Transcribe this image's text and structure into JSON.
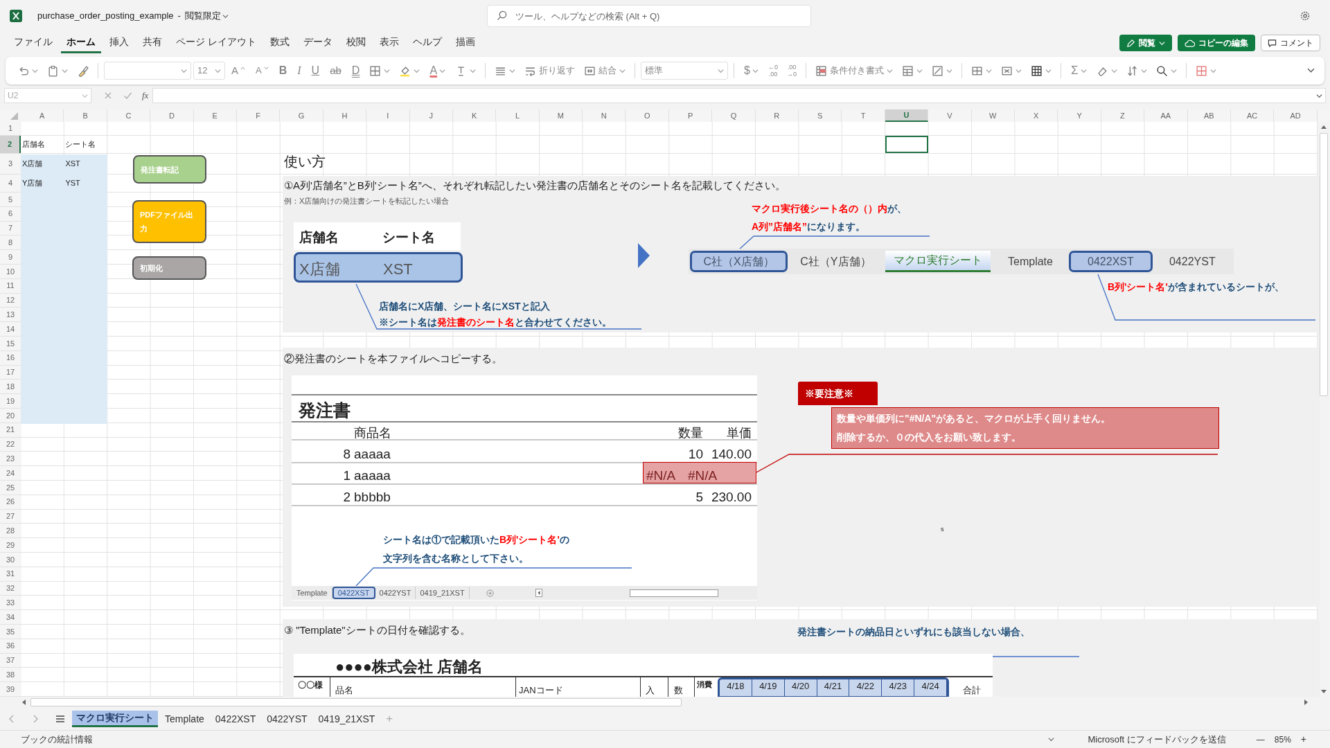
{
  "title_bar": {
    "file_name": "purchase_order_posting_example",
    "separator": "-",
    "mode": "閲覧限定",
    "search_placeholder": "ツール、ヘルプなどの検索 (Alt + Q)"
  },
  "menu_tabs": [
    {
      "label": "ファイル",
      "selected": false
    },
    {
      "label": "ホーム",
      "selected": true
    },
    {
      "label": "挿入",
      "selected": false
    },
    {
      "label": "共有",
      "selected": false
    },
    {
      "label": "ページ レイアウト",
      "selected": false
    },
    {
      "label": "数式",
      "selected": false
    },
    {
      "label": "データ",
      "selected": false
    },
    {
      "label": "校閲",
      "selected": false
    },
    {
      "label": "表示",
      "selected": false
    },
    {
      "label": "ヘルプ",
      "selected": false
    },
    {
      "label": "描画",
      "selected": false
    }
  ],
  "menu_buttons": [
    {
      "label": "閲覧",
      "kind": "mode"
    },
    {
      "label": "コピーの編集",
      "kind": "copy"
    },
    {
      "label": "コメント",
      "kind": "comment"
    }
  ],
  "ribbon": [
    {
      "kind": "undo",
      "caret": true
    },
    {
      "kind": "paste",
      "caret": true
    },
    {
      "kind": "brush",
      "caret": false
    },
    {
      "kind": "sep"
    },
    {
      "kind": "font_field"
    },
    {
      "kind": "size_field",
      "value": "12"
    },
    {
      "kind": "grow",
      "label": "A"
    },
    {
      "kind": "shrink",
      "label": "A"
    },
    {
      "kind": "bold",
      "label": "B"
    },
    {
      "kind": "italic",
      "label": "I"
    },
    {
      "kind": "underline",
      "label": "U"
    },
    {
      "kind": "strike",
      "label": "ab"
    },
    {
      "kind": "dunder",
      "label": "D"
    },
    {
      "kind": "border",
      "caret": true
    },
    {
      "kind": "fill",
      "caret": true
    },
    {
      "kind": "fontcolor",
      "label": "A",
      "caret": true
    },
    {
      "kind": "textdir",
      "caret": true
    },
    {
      "kind": "sep"
    },
    {
      "kind": "align",
      "caret": true
    },
    {
      "kind": "wrap",
      "label": "折り返す"
    },
    {
      "kind": "merge",
      "label": "結合",
      "caret": true
    },
    {
      "kind": "sep"
    },
    {
      "kind": "numfmt_field",
      "value": "標準"
    },
    {
      "kind": "sep"
    },
    {
      "kind": "currency",
      "label": "$",
      "caret": true
    },
    {
      "kind": "decimal",
      "top": "←0",
      "bottom": ".00"
    },
    {
      "kind": "decimal",
      "top": ".00",
      "bottom": "→0"
    },
    {
      "kind": "sep"
    },
    {
      "kind": "conditional",
      "label": "条件付き書式",
      "caret": true
    },
    {
      "kind": "table",
      "caret": true
    },
    {
      "kind": "cellstyle",
      "caret": true
    },
    {
      "kind": "sep"
    },
    {
      "kind": "insert",
      "caret": true
    },
    {
      "kind": "delete",
      "caret": true
    },
    {
      "kind": "format",
      "caret": true
    },
    {
      "kind": "sep"
    },
    {
      "kind": "sum",
      "label": "Σ",
      "caret": true
    },
    {
      "kind": "eraser",
      "caret": true
    },
    {
      "kind": "sort",
      "caret": true
    },
    {
      "kind": "find",
      "caret": true
    },
    {
      "kind": "sep"
    },
    {
      "kind": "gridstyle",
      "caret": true
    }
  ],
  "formula_bar": {
    "name_box": "U2",
    "fx": "fx"
  },
  "sheet": {
    "columns": [
      {
        "label": "A",
        "selected": false
      },
      {
        "label": "B",
        "selected": false
      },
      {
        "label": "C",
        "selected": false
      },
      {
        "label": "D",
        "selected": false
      },
      {
        "label": "E",
        "selected": false
      },
      {
        "label": "F",
        "selected": false
      },
      {
        "label": "G",
        "selected": false
      },
      {
        "label": "H",
        "selected": false
      },
      {
        "label": "I",
        "selected": false
      },
      {
        "label": "J",
        "selected": false
      },
      {
        "label": "K",
        "selected": false
      },
      {
        "label": "L",
        "selected": false
      },
      {
        "label": "M",
        "selected": false
      },
      {
        "label": "N",
        "selected": false
      },
      {
        "label": "O",
        "selected": false
      },
      {
        "label": "P",
        "selected": false
      },
      {
        "label": "Q",
        "selected": false
      },
      {
        "label": "R",
        "selected": false
      },
      {
        "label": "S",
        "selected": false
      },
      {
        "label": "T",
        "selected": false
      },
      {
        "label": "U",
        "selected": true
      },
      {
        "label": "V",
        "selected": false
      },
      {
        "label": "W",
        "selected": false
      },
      {
        "label": "X",
        "selected": false
      },
      {
        "label": "Y",
        "selected": false
      },
      {
        "label": "Z",
        "selected": false
      },
      {
        "label": "AA",
        "selected": false
      },
      {
        "label": "AB",
        "selected": false
      },
      {
        "label": "AC",
        "selected": false
      },
      {
        "label": "AD",
        "selected": false
      }
    ],
    "rows": [
      {
        "label": "1",
        "selected": false
      },
      {
        "label": "2",
        "selected": true,
        "cells": [
          "店舗名",
          "シート名"
        ]
      },
      {
        "label": "3",
        "selected": false,
        "cells": [
          "X店舗",
          "XST"
        ]
      },
      {
        "label": "4",
        "selected": false,
        "cells": [
          "Y店舗",
          "YST"
        ]
      },
      {
        "label": "5",
        "selected": false
      },
      {
        "label": "6",
        "selected": false
      },
      {
        "label": "7",
        "selected": false
      },
      {
        "label": "8",
        "selected": false
      },
      {
        "label": "9",
        "selected": false
      },
      {
        "label": "10",
        "selected": false
      },
      {
        "label": "11",
        "selected": false
      },
      {
        "label": "12",
        "selected": false
      },
      {
        "label": "13",
        "selected": false
      },
      {
        "label": "14",
        "selected": false
      },
      {
        "label": "15",
        "selected": false
      },
      {
        "label": "16",
        "selected": false
      },
      {
        "label": "17",
        "selected": false
      },
      {
        "label": "18",
        "selected": false
      },
      {
        "label": "19",
        "selected": false
      },
      {
        "label": "20",
        "selected": false
      },
      {
        "label": "21",
        "selected": false
      },
      {
        "label": "22",
        "selected": false
      },
      {
        "label": "23",
        "selected": false
      },
      {
        "label": "24",
        "selected": false
      },
      {
        "label": "25",
        "selected": false
      },
      {
        "label": "26",
        "selected": false
      },
      {
        "label": "27",
        "selected": false
      },
      {
        "label": "28",
        "selected": false
      },
      {
        "label": "29",
        "selected": false
      },
      {
        "label": "30",
        "selected": false
      },
      {
        "label": "31",
        "selected": false
      },
      {
        "label": "32",
        "selected": false
      },
      {
        "label": "33",
        "selected": false
      },
      {
        "label": "34",
        "selected": false
      },
      {
        "label": "35",
        "selected": false
      },
      {
        "label": "36",
        "selected": false
      },
      {
        "label": "37",
        "selected": false
      },
      {
        "label": "38",
        "selected": false
      },
      {
        "label": "39",
        "selected": false
      }
    ]
  },
  "macro_buttons": [
    {
      "label": "発注書転記",
      "color": "#a9d18e"
    },
    {
      "label": "PDFファイル出力",
      "color": "#ffc000"
    },
    {
      "label": "初期化",
      "color": "#aaa6a6"
    }
  ],
  "guide": {
    "heading": "使い方",
    "step1": {
      "title": "①A列'店舗名”とB列'シート名”へ、それぞれ転記したい発注書の店舗名とそのシート名を記載してください。",
      "note": "例：X店舗向けの発注書シートを転記したい場合",
      "example_headers": [
        "店舗名",
        "シート名"
      ],
      "example_values": [
        "X店舗",
        "XST"
      ],
      "callout_entry": [
        [
          {
            "text": "店舗名にX店舗、シート名にXSTと記入",
            "emphasis": false
          }
        ],
        [
          {
            "text": "※シート名は",
            "emphasis": false
          },
          {
            "text": "発注書のシート名",
            "emphasis": true
          },
          {
            "text": "と合わせてください。",
            "emphasis": false
          }
        ]
      ],
      "callout_result": [
        [
          {
            "text": "マクロ実行後シート名の（）内",
            "emphasis": true
          },
          {
            "text": "が、",
            "emphasis": false
          }
        ],
        [
          {
            "text": "A列”店舗名”",
            "emphasis": true
          },
          {
            "text": "になります。",
            "emphasis": false
          }
        ]
      ],
      "tab_strip": [
        {
          "label": "C社（X店舗）",
          "highlighted": true,
          "active": false
        },
        {
          "label": "C社（Y店舗）",
          "highlighted": false,
          "active": false
        },
        {
          "label": "マクロ実行シート",
          "highlighted": false,
          "active": true
        },
        {
          "label": "Template",
          "highlighted": false,
          "active": false
        },
        {
          "label": "0422XST",
          "highlighted": true,
          "active": false
        },
        {
          "label": "0422YST",
          "highlighted": false,
          "active": false
        }
      ],
      "callout_sheet": [
        [
          {
            "text": "B列'シート名'",
            "emphasis": true
          },
          {
            "text": "が含まれているシートが、",
            "emphasis": false
          }
        ]
      ]
    },
    "step2": {
      "title": "②発注書のシートを本ファイルへコピーする。",
      "order_form": {
        "title": "発注書",
        "headers": [
          "商品名",
          "数量",
          "単価"
        ],
        "rows": [
          {
            "cells": [
              "8",
              "aaaaa",
              "10",
              "140.00"
            ],
            "flagged": false
          },
          {
            "cells": [
              "1",
              "aaaaa",
              "#N/A",
              "#N/A"
            ],
            "flagged": true
          },
          {
            "cells": [
              "2",
              "bbbbb",
              "5",
              "230.00"
            ],
            "flagged": false
          }
        ],
        "sheet_tabs": [
          {
            "label": "Template",
            "highlighted": false
          },
          {
            "label": "0422XST",
            "highlighted": true
          },
          {
            "label": "0422YST",
            "highlighted": false
          },
          {
            "label": "0419_21XST",
            "highlighted": false
          }
        ]
      },
      "callout": [
        [
          {
            "text": "シート名は①で記載頂いた",
            "emphasis": false
          },
          {
            "text": "B列'シート名'",
            "emphasis": true
          },
          {
            "text": "の",
            "emphasis": false
          }
        ],
        [
          {
            "text": "文字列を含む名称として下さい。",
            "emphasis": false
          }
        ]
      ],
      "warning": {
        "badge": "※要注意※",
        "lines": [
          "数量や単価列に\"#N/A\"があると、マクロが上手く回りません。",
          "削除するか、０の代入をお願い致します。"
        ]
      },
      "stray": "s"
    },
    "step3": {
      "title": "③ \"Template\"シートの日付を確認する。",
      "callout": "発注書シートの納品日といずれにも該当しない場合、",
      "template": {
        "company": "●●●●株式会社 店舗名",
        "labels": [
          "〇〇様",
          "品名",
          "JANコード",
          "入",
          "数",
          "消費"
        ],
        "dates": [
          "4/18",
          "4/19",
          "4/20",
          "4/21",
          "4/22",
          "4/23",
          "4/24"
        ],
        "total": "合計"
      }
    }
  },
  "sheet_tabs": [
    {
      "label": "マクロ実行シート",
      "selected": true
    },
    {
      "label": "Template",
      "selected": false
    },
    {
      "label": "0422XST",
      "selected": false
    },
    {
      "label": "0422YST",
      "selected": false
    },
    {
      "label": "0419_21XST",
      "selected": false
    }
  ],
  "add_sheet": "+",
  "status_bar": {
    "left": "ブックの統計情報",
    "feedback": "Microsoft にフィードバックを送信",
    "zoom_out": "—",
    "zoom": "85%",
    "zoom_in": "+"
  }
}
